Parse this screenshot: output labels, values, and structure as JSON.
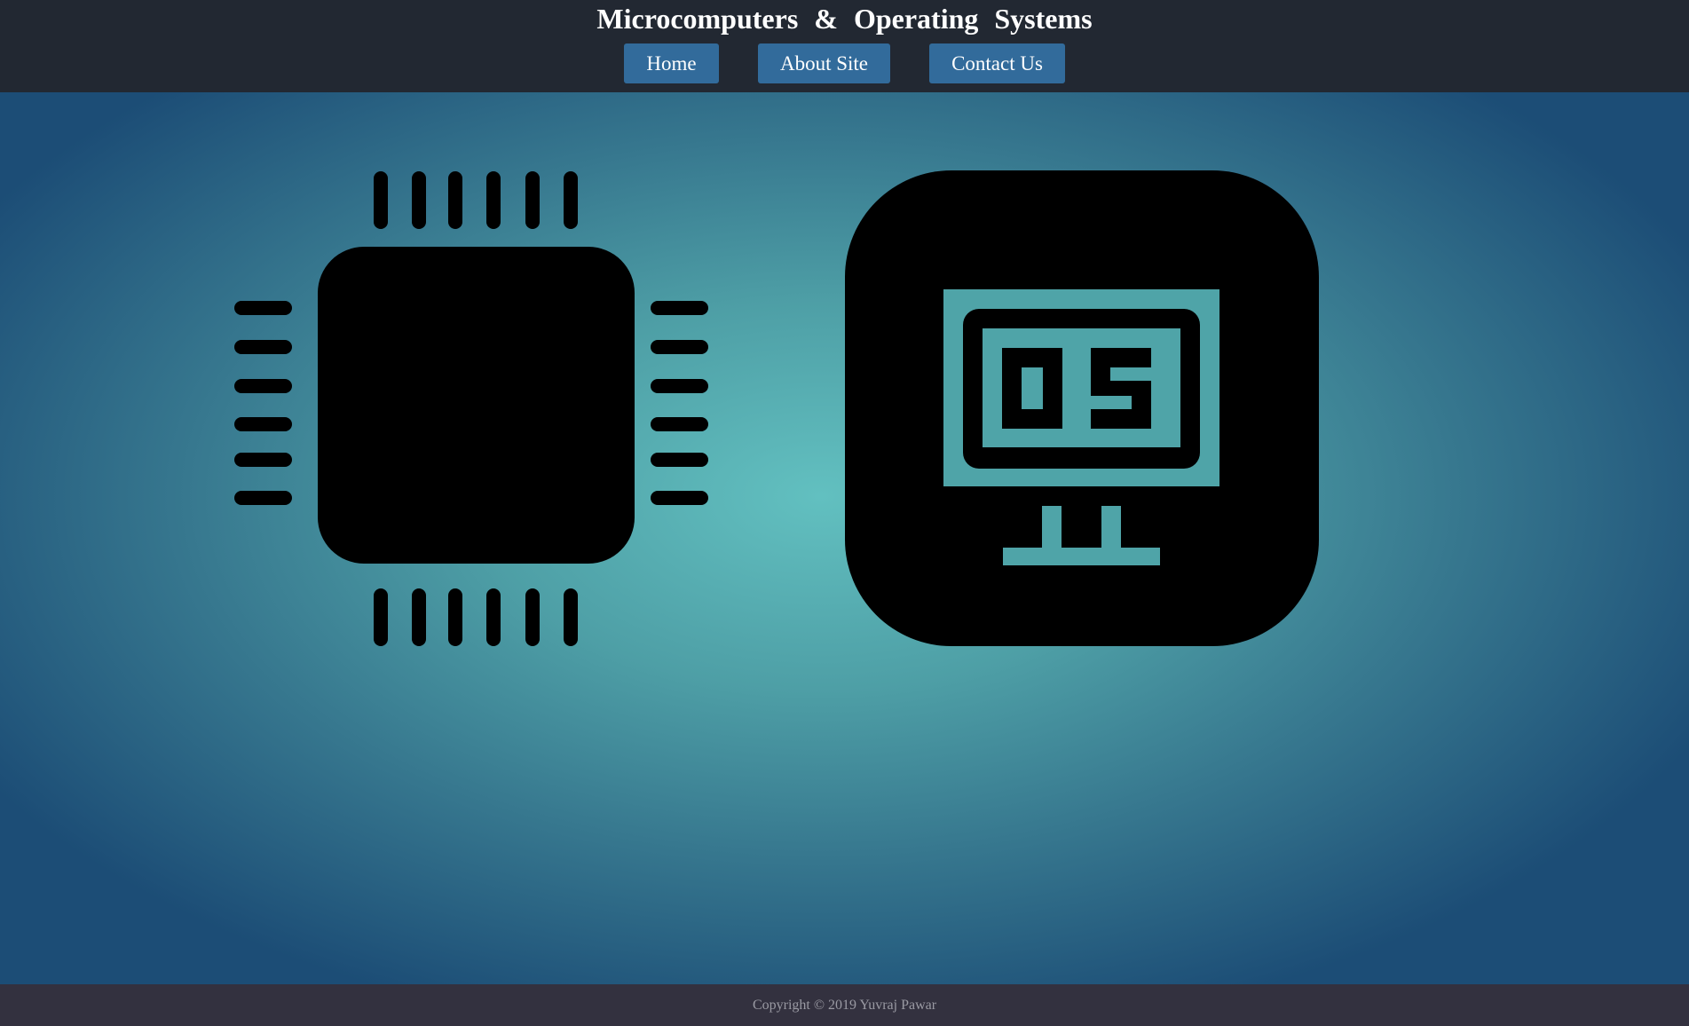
{
  "header": {
    "title": "Microcomputers & Operating Systems",
    "nav": {
      "home_label": "Home",
      "about_label": "About Site",
      "contact_label": "Contact Us"
    }
  },
  "main": {
    "icons": [
      "microchip-icon",
      "os-monitor-icon"
    ],
    "os_icon_text": "OS"
  },
  "footer": {
    "copyright": "Copyright © 2019 Yuvraj Pawar"
  },
  "colors": {
    "header_bg": "#222832",
    "nav_button_bg": "#326b9b",
    "footer_bg": "#33313f",
    "gradient_center": "#62c0c0",
    "gradient_edge": "#1c4d76"
  }
}
